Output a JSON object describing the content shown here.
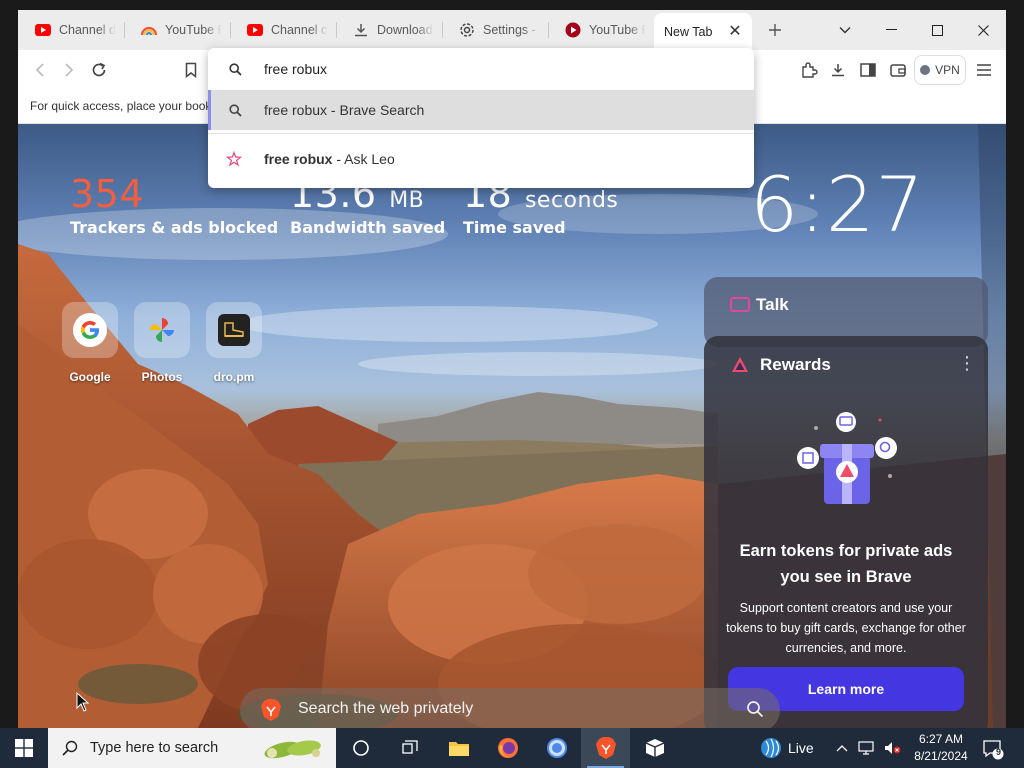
{
  "tabs": [
    {
      "title": "Channel d",
      "favicon": "youtube-favicon"
    },
    {
      "title": "YouTube R",
      "favicon": "rainbow-favicon"
    },
    {
      "title": "Channel c",
      "favicon": "youtube-favicon"
    },
    {
      "title": "Download",
      "favicon": "download-icon"
    },
    {
      "title": "Settings -",
      "favicon": "gear-icon"
    },
    {
      "title": "YouTube R",
      "favicon": "red-circle-favicon"
    },
    {
      "title": "New Tab",
      "favicon": "none",
      "active": true
    }
  ],
  "toolbar": {
    "vpn_label": "VPN"
  },
  "bookmarks_bar": {
    "hint": "For quick access, place your book"
  },
  "omnibox": {
    "query": "free robux",
    "suggestions": [
      {
        "text": "free robux - Brave Search",
        "icon": "search-icon"
      },
      {
        "bold": "free robux",
        "rest": " - Ask Leo",
        "icon": "leo-icon"
      }
    ]
  },
  "ntp": {
    "stats": {
      "trackers_value": "354",
      "trackers_label": "Trackers & ads blocked",
      "bandwidth_value": "13.6",
      "bandwidth_unit": "MB",
      "bandwidth_label": "Bandwidth saved",
      "time_value": "18",
      "time_unit": "seconds",
      "time_label": "Time saved"
    },
    "clock": "6:27",
    "top_sites": [
      {
        "label": "Google",
        "icon": "google-icon"
      },
      {
        "label": "Photos",
        "icon": "photos-icon"
      },
      {
        "label": "dro.pm",
        "icon": "boot-icon"
      }
    ],
    "talk": {
      "title": "Talk"
    },
    "rewards": {
      "title": "Rewards",
      "headline": "Earn tokens for private ads you see in Brave",
      "body": "Support content creators and use your tokens to buy gift cards, exchange for other currencies, and more.",
      "button": "Learn more"
    },
    "search_placeholder": "Search the web privately"
  },
  "taskbar": {
    "search_placeholder": "Type here to search",
    "live_label": "Live",
    "time": "6:27 AM",
    "date": "8/21/2024",
    "notification_count": "9"
  },
  "colors": {
    "accent_blue": "#4436e0",
    "trackers_orange": "#f06040",
    "brave_orange": "#fb542b"
  }
}
